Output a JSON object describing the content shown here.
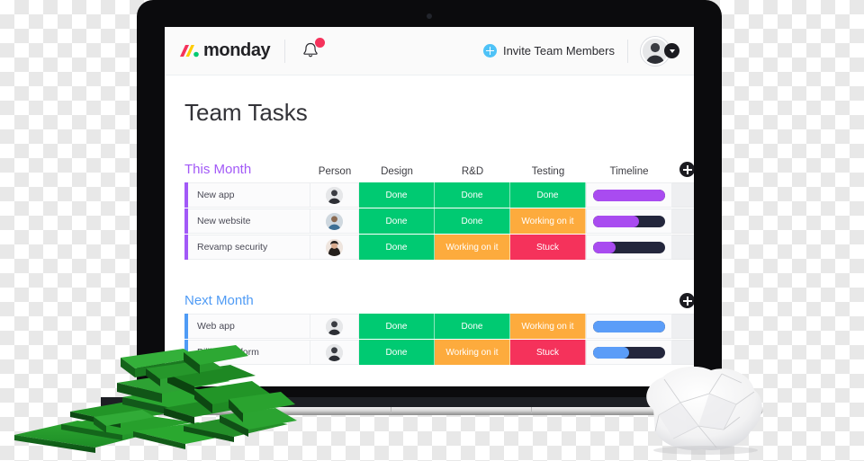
{
  "app": {
    "brand_name": "monday",
    "notification_icon": "bell-icon",
    "invite_label": "Invite Team Members",
    "invite_icon": "plus-circle-icon",
    "avatar_icon": "user-avatar",
    "avatar_caret_icon": "chevron-down-icon"
  },
  "board": {
    "title": "Team Tasks",
    "columns": [
      "Person",
      "Design",
      "R&D",
      "Testing",
      "Timeline"
    ],
    "add_column_icon": "plus-circle-icon",
    "groups": [
      {
        "name": "This Month",
        "color": "#a259f7",
        "timeline_color": "#a94bf0",
        "rows": [
          {
            "task": "New app",
            "person": "avatar-1",
            "design": {
              "label": "Done",
              "color": "#00ca72"
            },
            "rnd": {
              "label": "Done",
              "color": "#00ca72"
            },
            "testing": {
              "label": "Done",
              "color": "#00ca72"
            },
            "timeline_percent": 100
          },
          {
            "task": "New website",
            "person": "avatar-2",
            "design": {
              "label": "Done",
              "color": "#00ca72"
            },
            "rnd": {
              "label": "Done",
              "color": "#00ca72"
            },
            "testing": {
              "label": "Working on it",
              "color": "#fdab3d"
            },
            "timeline_percent": 64
          },
          {
            "task": "Revamp security",
            "person": "avatar-3",
            "design": {
              "label": "Done",
              "color": "#00ca72"
            },
            "rnd": {
              "label": "Working on it",
              "color": "#fdab3d"
            },
            "testing": {
              "label": "Stuck",
              "color": "#f5325b"
            },
            "timeline_percent": 31
          }
        ]
      },
      {
        "name": "Next Month",
        "color": "#4f9bf5",
        "timeline_color": "#5b9df8",
        "rows": [
          {
            "task": "Web app",
            "person": "avatar-1",
            "design": {
              "label": "Done",
              "color": "#00ca72"
            },
            "rnd": {
              "label": "Done",
              "color": "#00ca72"
            },
            "testing": {
              "label": "Working on it",
              "color": "#fdab3d"
            },
            "timeline_percent": 100
          },
          {
            "task": "Billing platform",
            "person": "avatar-1",
            "design": {
              "label": "Done",
              "color": "#00ca72"
            },
            "rnd": {
              "label": "Working on it",
              "color": "#fdab3d"
            },
            "testing": {
              "label": "Stuck",
              "color": "#f5325b"
            },
            "timeline_percent": 50
          }
        ]
      }
    ]
  },
  "scene": {
    "laptop": "laptop-device",
    "blocks": "green-wooden-blocks-pile",
    "paper": "crumpled-paper-ball"
  }
}
